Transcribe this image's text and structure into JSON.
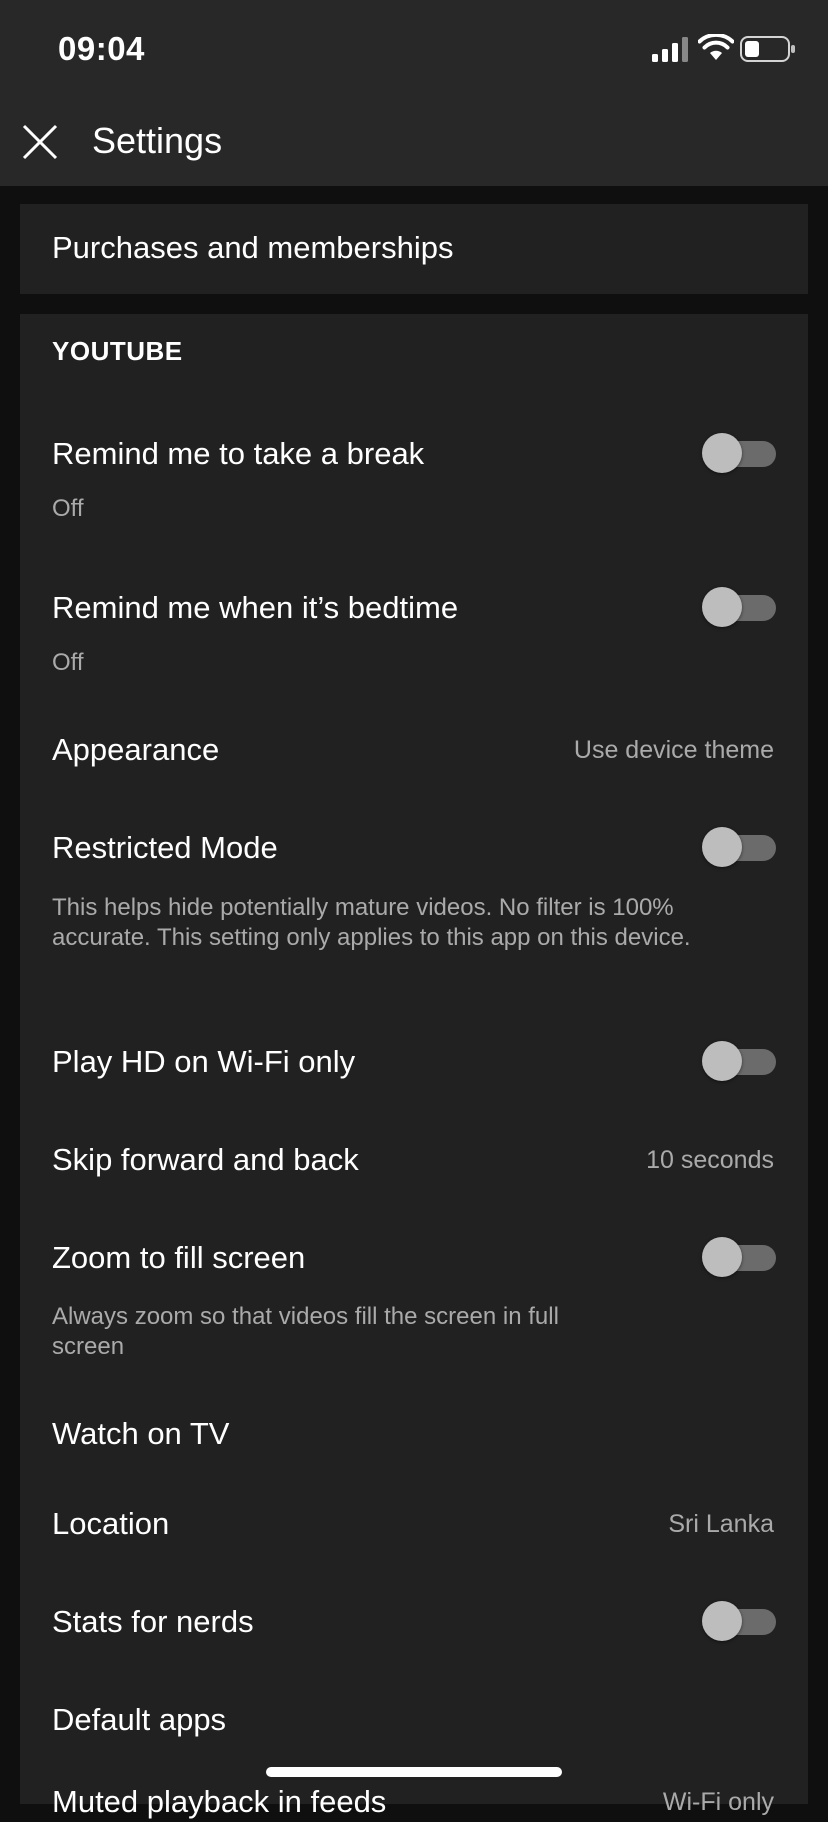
{
  "status_bar": {
    "time": "09:04"
  },
  "header": {
    "title": "Settings"
  },
  "purchases": {
    "label": "Purchases and memberships"
  },
  "youtube_section": {
    "title": "YOUTUBE",
    "items": [
      {
        "label": "Remind me to take a break",
        "subtitle": "Off",
        "type": "toggle",
        "enabled": false
      },
      {
        "label": "Remind me when it’s bedtime",
        "subtitle": "Off",
        "type": "toggle",
        "enabled": false
      },
      {
        "label": "Appearance",
        "value": "Use device theme",
        "type": "value"
      },
      {
        "label": "Restricted Mode",
        "subtitle": "This helps hide potentially mature videos. No filter is 100% accurate. This setting only applies to this app on this device.",
        "type": "toggle",
        "enabled": false
      },
      {
        "label": "Play HD on Wi-Fi only",
        "type": "toggle",
        "enabled": false
      },
      {
        "label": "Skip forward and back",
        "value": "10 seconds",
        "type": "value"
      },
      {
        "label": "Zoom to fill screen",
        "subtitle": "Always zoom so that videos fill the screen in full screen",
        "type": "toggle",
        "enabled": false
      },
      {
        "label": "Watch on TV",
        "type": "link"
      },
      {
        "label": "Location",
        "value": "Sri Lanka",
        "type": "value"
      },
      {
        "label": "Stats for nerds",
        "type": "toggle",
        "enabled": false
      },
      {
        "label": "Default apps",
        "type": "link"
      },
      {
        "label": "Muted playback in feeds",
        "value": "Wi-Fi only",
        "type": "value"
      }
    ]
  },
  "colors": {
    "background": "#0f0f0f",
    "header": "#282828",
    "card": "#212121",
    "text_primary": "#ffffff",
    "text_secondary": "#aaaaaa",
    "toggle_track": "#6b6b6b",
    "toggle_knob": "#bdbdbd"
  },
  "icons": [
    "signal-icon",
    "wifi-icon",
    "battery-icon",
    "close-icon"
  ]
}
